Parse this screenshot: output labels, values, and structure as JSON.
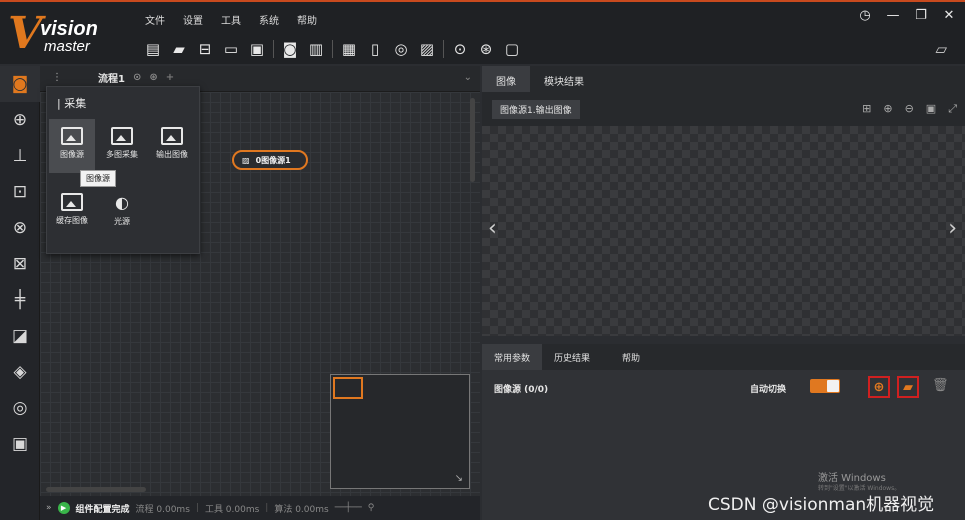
{
  "app": {
    "logo_main": "vision",
    "logo_sub": "master",
    "logo_letter": "V"
  },
  "menu": [
    "文件",
    "设置",
    "工具",
    "系统",
    "帮助"
  ],
  "flow_tab": {
    "label": "流程1"
  },
  "tool_popup": {
    "title": "| 采集",
    "tools": [
      "图像源",
      "多图采集",
      "输出图像",
      "缓存图像",
      "光源"
    ],
    "tooltip": "图像源"
  },
  "node": {
    "label": "0图像源1"
  },
  "status": {
    "main": "组件配置完成",
    "flow": "流程 0.00ms",
    "tool": "工具 0.00ms",
    "algo": "算法 0.00ms"
  },
  "right_tabs": [
    "图像",
    "模块结果"
  ],
  "image_select": "图像源1.输出图像",
  "param_tabs": [
    "常用参数",
    "历史结果",
    "帮助"
  ],
  "params": {
    "source_label": "图像源 (0/0)",
    "auto_switch_label": "自动切换"
  },
  "overlay": {
    "activate_title": "激活 Windows",
    "activate_sub": "转到\"设置\"以激活 Windows。",
    "watermark": "CSDN @visionman机器视觉"
  },
  "colors": {
    "accent": "#e07820",
    "highlight": "#d02020"
  }
}
